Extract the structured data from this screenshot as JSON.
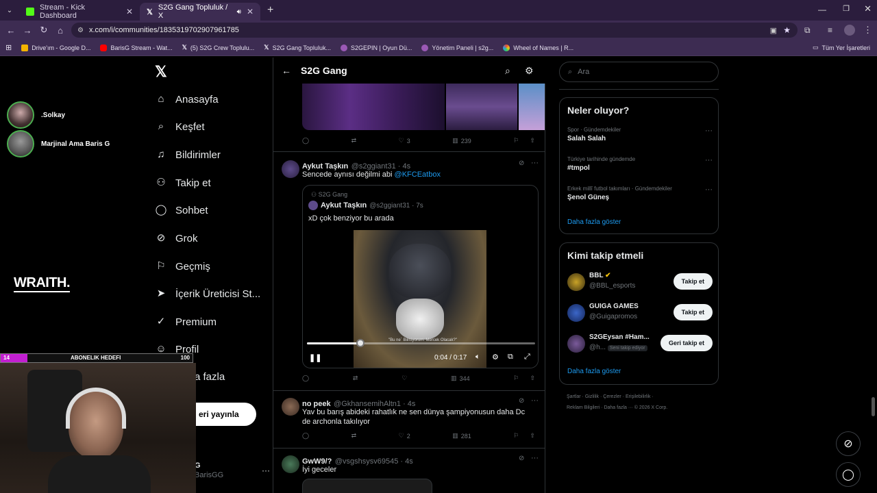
{
  "tabs": [
    {
      "label": "Stream - Kick Dashboard",
      "fav_color": "#53fc18"
    },
    {
      "label": "S2G Gang Topluluk / X",
      "fav_color": "#ffffff"
    }
  ],
  "url": "x.com/i/communities/1835319702907961785",
  "bookmarks": [
    {
      "label": "Drive'ım - Google D...",
      "color": "#f4b400"
    },
    {
      "label": "BarisG Stream - Wat...",
      "color": "#ff0000"
    },
    {
      "label": "(5) S2G Crew Toplulu...",
      "color": "#ffffff"
    },
    {
      "label": "S2G Gang Topluluk...",
      "color": "#ffffff"
    },
    {
      "label": "S2GEPIN | Oyun Dü...",
      "color": "#9b59b6"
    },
    {
      "label": "Yönetim Paneli | s2g...",
      "color": "#9b59b6"
    },
    {
      "label": "Wheel of Names | R...",
      "color": "#e74c3c"
    }
  ],
  "bookmarks_all": "Tüm Yer İşaretleri",
  "stream": {
    "viewers": [
      {
        "name": ".Solkay"
      },
      {
        "name": "Marjinal Ama Baris G"
      }
    ],
    "sponsor": "WRAITH.",
    "goal_current": "14",
    "goal_label": "ABONELIK HEDEFI",
    "goal_target": "100",
    "goal_fraction": 0.14
  },
  "nav": {
    "items": [
      {
        "label": "Anasayfa",
        "icon": "home-icon",
        "glyph": "⌂"
      },
      {
        "label": "Keşfet",
        "icon": "search-icon",
        "glyph": "⌕"
      },
      {
        "label": "Bildirimler",
        "icon": "bell-icon",
        "glyph": "♫"
      },
      {
        "label": "Takip et",
        "icon": "person-plus-icon",
        "glyph": "⚇"
      },
      {
        "label": "Sohbet",
        "icon": "chat-icon",
        "glyph": "◯"
      },
      {
        "label": "Grok",
        "icon": "grok-icon",
        "glyph": "⊘"
      },
      {
        "label": "Geçmiş",
        "icon": "bookmark-icon",
        "glyph": "⚐"
      },
      {
        "label": "İçerik Üreticisi St...",
        "icon": "rocket-icon",
        "glyph": "➤"
      },
      {
        "label": "Premium",
        "icon": "verified-icon",
        "glyph": "✓"
      },
      {
        "label": "Profil",
        "icon": "profile-icon",
        "glyph": "☺"
      },
      {
        "label": "a fazla",
        "icon": "more-icon",
        "glyph": "⋯"
      }
    ],
    "post_label": "eri yayınla",
    "account_name": "G",
    "account_handle": "BarisGG"
  },
  "feed": {
    "title": "S2G Gang",
    "tweet1_actions": {
      "replies": "",
      "retweets": "",
      "likes": "3",
      "views": "239"
    },
    "tweet2": {
      "name": "Aykut Taşkın",
      "handle": "@s2ggiant31 · 4s",
      "text": "Sencede aynısı değilmi abi",
      "mention": "@KFCEatbox",
      "quote": {
        "community": "S2G Gang",
        "name": "Aykut Taşkın",
        "handle": "@s2ggiant31 · 7s",
        "text": "xD çok benziyor bu arada"
      },
      "video": {
        "time": "0:04 / 0:17",
        "progress": 0.235,
        "caption": "\"Bu ne´ Bilmiyorum. Mercek Olacak?\""
      },
      "actions": {
        "replies": "",
        "retweets": "",
        "likes": "",
        "views": "344"
      }
    },
    "tweet3": {
      "name": "no peek",
      "handle": "@GkhansemihAltn1 · 4s",
      "text": "Yav bu barış abideki rahatlık ne sen dünya şampiyonusun daha Dc de archonla takılıyor",
      "actions": {
        "replies": "",
        "retweets": "",
        "likes": "2",
        "views": "281"
      }
    },
    "tweet4": {
      "name": "GwW9/?",
      "handle": "@vsgshsysv69545 · 4s",
      "text": "İyi geceler"
    }
  },
  "right": {
    "search_placeholder": "Ara",
    "trends_title": "Neler oluyor?",
    "trends": [
      {
        "category": "Spor · Gündemdekiler",
        "name": "Salah Salah"
      },
      {
        "category": "Türkiye tarihinde gündemde",
        "name": "#tmpol"
      },
      {
        "category": "Erkek millî futbol takımları · Gündemdekiler",
        "name": "Şenol Güneş"
      }
    ],
    "show_more": "Daha fazla göster",
    "who_title": "Kimi takip etmeli",
    "who": [
      {
        "name": "BBL",
        "handle": "@BBL_esports",
        "button": "Takip et",
        "verified": true,
        "color": "#c9a227"
      },
      {
        "name": "GUIGA GAMES",
        "handle": "@Guigapromos",
        "button": "Takip et",
        "verified": false,
        "color": "#1a3a8f"
      },
      {
        "name": "S2GEysan #Ham...",
        "handle": "@h...",
        "badge": "Seni takip ediyor",
        "button": "Geri takip et",
        "verified": false,
        "color": "#3a3f7a"
      }
    ],
    "who_more": "Daha fazla göster",
    "footer1": "Şartlar ·  Gizlilik ·  Çerezler ·  Erişilebilirlik ·",
    "footer2": "Reklam Bilgileri ·  Daha fazla ···  © 2026 X Corp."
  }
}
